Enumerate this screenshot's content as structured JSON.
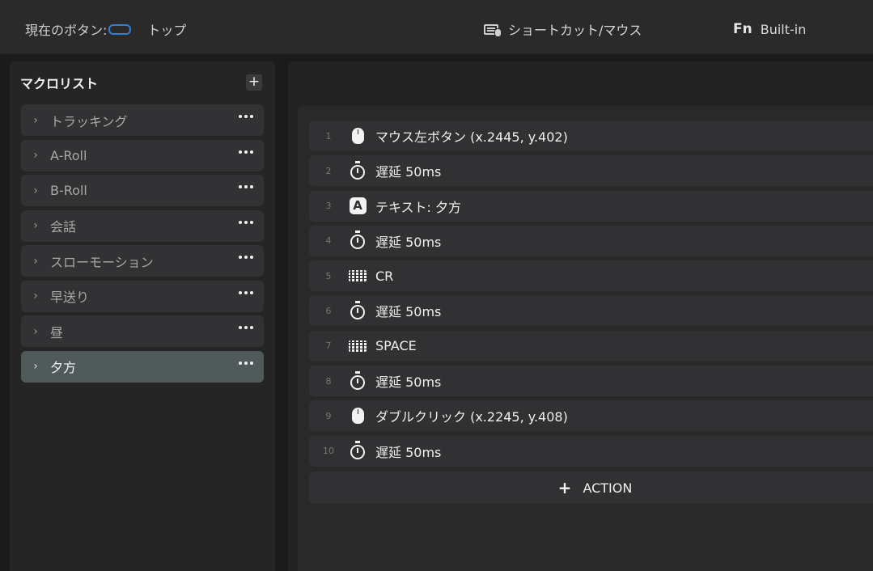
{
  "header": {
    "current_button_label": "現在のボタン:",
    "page_label": "トップ",
    "shortcut_label": "ショートカット/マウス",
    "fn_icon": "Fn",
    "builtin_label": "Built-in"
  },
  "sidebar": {
    "title": "マクロリスト",
    "add_icon": "+",
    "chevron": "›",
    "items": [
      {
        "label": "トラッキング"
      },
      {
        "label": "A-Roll"
      },
      {
        "label": "B-Roll"
      },
      {
        "label": "会話"
      },
      {
        "label": "スローモーション"
      },
      {
        "label": "早送り"
      },
      {
        "label": "昼"
      },
      {
        "label": "夕方",
        "active": true
      }
    ]
  },
  "actions": [
    {
      "num": "1",
      "icon": "mouse-icon",
      "label": "マウス左ボタン (x.2445, y.402)"
    },
    {
      "num": "2",
      "icon": "timer-icon",
      "label": "遅延 50ms"
    },
    {
      "num": "3",
      "icon": "text-icon",
      "label": "テキスト: 夕方"
    },
    {
      "num": "4",
      "icon": "timer-icon",
      "label": "遅延 50ms"
    },
    {
      "num": "5",
      "icon": "keyboard-icon",
      "label": "CR"
    },
    {
      "num": "6",
      "icon": "timer-icon",
      "label": "遅延 50ms"
    },
    {
      "num": "7",
      "icon": "keyboard-icon",
      "label": "SPACE"
    },
    {
      "num": "8",
      "icon": "timer-icon",
      "label": "遅延 50ms"
    },
    {
      "num": "9",
      "icon": "mouse-icon",
      "label": "ダブルクリック (x.2245, y.408)"
    },
    {
      "num": "10",
      "icon": "timer-icon",
      "label": "遅延 50ms"
    }
  ],
  "text_icon_glyph": "A",
  "add_action": {
    "plus": "+",
    "label": "ACTION"
  },
  "colors": {
    "accent": "#2f7fd6",
    "active_item": "#515a5a",
    "background": "#1b1b1c"
  }
}
